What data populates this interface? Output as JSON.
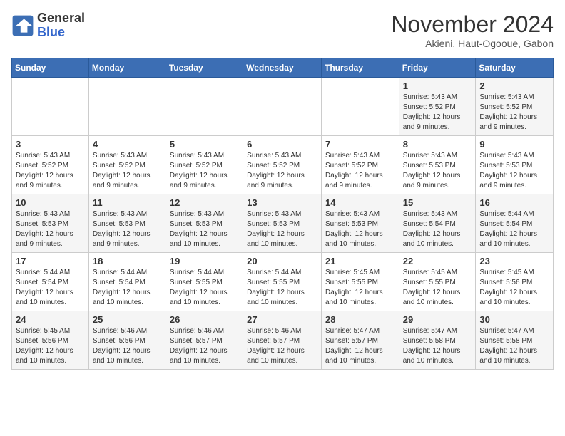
{
  "logo": {
    "line1": "General",
    "line2": "Blue"
  },
  "title": "November 2024",
  "location": "Akieni, Haut-Ogooue, Gabon",
  "days_of_week": [
    "Sunday",
    "Monday",
    "Tuesday",
    "Wednesday",
    "Thursday",
    "Friday",
    "Saturday"
  ],
  "weeks": [
    [
      {
        "day": "",
        "info": ""
      },
      {
        "day": "",
        "info": ""
      },
      {
        "day": "",
        "info": ""
      },
      {
        "day": "",
        "info": ""
      },
      {
        "day": "",
        "info": ""
      },
      {
        "day": "1",
        "info": "Sunrise: 5:43 AM\nSunset: 5:52 PM\nDaylight: 12 hours and 9 minutes."
      },
      {
        "day": "2",
        "info": "Sunrise: 5:43 AM\nSunset: 5:52 PM\nDaylight: 12 hours and 9 minutes."
      }
    ],
    [
      {
        "day": "3",
        "info": "Sunrise: 5:43 AM\nSunset: 5:52 PM\nDaylight: 12 hours and 9 minutes."
      },
      {
        "day": "4",
        "info": "Sunrise: 5:43 AM\nSunset: 5:52 PM\nDaylight: 12 hours and 9 minutes."
      },
      {
        "day": "5",
        "info": "Sunrise: 5:43 AM\nSunset: 5:52 PM\nDaylight: 12 hours and 9 minutes."
      },
      {
        "day": "6",
        "info": "Sunrise: 5:43 AM\nSunset: 5:52 PM\nDaylight: 12 hours and 9 minutes."
      },
      {
        "day": "7",
        "info": "Sunrise: 5:43 AM\nSunset: 5:52 PM\nDaylight: 12 hours and 9 minutes."
      },
      {
        "day": "8",
        "info": "Sunrise: 5:43 AM\nSunset: 5:53 PM\nDaylight: 12 hours and 9 minutes."
      },
      {
        "day": "9",
        "info": "Sunrise: 5:43 AM\nSunset: 5:53 PM\nDaylight: 12 hours and 9 minutes."
      }
    ],
    [
      {
        "day": "10",
        "info": "Sunrise: 5:43 AM\nSunset: 5:53 PM\nDaylight: 12 hours and 9 minutes."
      },
      {
        "day": "11",
        "info": "Sunrise: 5:43 AM\nSunset: 5:53 PM\nDaylight: 12 hours and 9 minutes."
      },
      {
        "day": "12",
        "info": "Sunrise: 5:43 AM\nSunset: 5:53 PM\nDaylight: 12 hours and 10 minutes."
      },
      {
        "day": "13",
        "info": "Sunrise: 5:43 AM\nSunset: 5:53 PM\nDaylight: 12 hours and 10 minutes."
      },
      {
        "day": "14",
        "info": "Sunrise: 5:43 AM\nSunset: 5:53 PM\nDaylight: 12 hours and 10 minutes."
      },
      {
        "day": "15",
        "info": "Sunrise: 5:43 AM\nSunset: 5:54 PM\nDaylight: 12 hours and 10 minutes."
      },
      {
        "day": "16",
        "info": "Sunrise: 5:44 AM\nSunset: 5:54 PM\nDaylight: 12 hours and 10 minutes."
      }
    ],
    [
      {
        "day": "17",
        "info": "Sunrise: 5:44 AM\nSunset: 5:54 PM\nDaylight: 12 hours and 10 minutes."
      },
      {
        "day": "18",
        "info": "Sunrise: 5:44 AM\nSunset: 5:54 PM\nDaylight: 12 hours and 10 minutes."
      },
      {
        "day": "19",
        "info": "Sunrise: 5:44 AM\nSunset: 5:55 PM\nDaylight: 12 hours and 10 minutes."
      },
      {
        "day": "20",
        "info": "Sunrise: 5:44 AM\nSunset: 5:55 PM\nDaylight: 12 hours and 10 minutes."
      },
      {
        "day": "21",
        "info": "Sunrise: 5:45 AM\nSunset: 5:55 PM\nDaylight: 12 hours and 10 minutes."
      },
      {
        "day": "22",
        "info": "Sunrise: 5:45 AM\nSunset: 5:55 PM\nDaylight: 12 hours and 10 minutes."
      },
      {
        "day": "23",
        "info": "Sunrise: 5:45 AM\nSunset: 5:56 PM\nDaylight: 12 hours and 10 minutes."
      }
    ],
    [
      {
        "day": "24",
        "info": "Sunrise: 5:45 AM\nSunset: 5:56 PM\nDaylight: 12 hours and 10 minutes."
      },
      {
        "day": "25",
        "info": "Sunrise: 5:46 AM\nSunset: 5:56 PM\nDaylight: 12 hours and 10 minutes."
      },
      {
        "day": "26",
        "info": "Sunrise: 5:46 AM\nSunset: 5:57 PM\nDaylight: 12 hours and 10 minutes."
      },
      {
        "day": "27",
        "info": "Sunrise: 5:46 AM\nSunset: 5:57 PM\nDaylight: 12 hours and 10 minutes."
      },
      {
        "day": "28",
        "info": "Sunrise: 5:47 AM\nSunset: 5:57 PM\nDaylight: 12 hours and 10 minutes."
      },
      {
        "day": "29",
        "info": "Sunrise: 5:47 AM\nSunset: 5:58 PM\nDaylight: 12 hours and 10 minutes."
      },
      {
        "day": "30",
        "info": "Sunrise: 5:47 AM\nSunset: 5:58 PM\nDaylight: 12 hours and 10 minutes."
      }
    ]
  ]
}
